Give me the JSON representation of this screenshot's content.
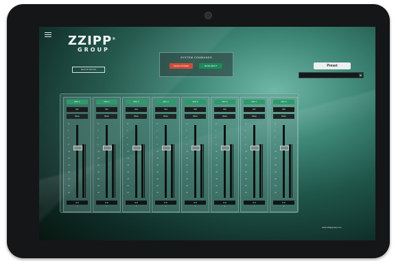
{
  "logo": {
    "line1": "ZZIPP",
    "line2": "GROUP"
  },
  "ip_box": "Neon IP 10.0.0.0",
  "system_commands": {
    "title": "SYSTEM COMMANDS",
    "btn_mute": "MUTE SYSTEM",
    "btn_unmute": "MUTE INPUT"
  },
  "preset": {
    "label": "Preset",
    "selected": ""
  },
  "strips": [
    {
      "name": "MIC 1",
      "label": "IN1",
      "mute": "Mute",
      "value": "0.0",
      "num": "1"
    },
    {
      "name": "MIC 2",
      "label": "IN2",
      "mute": "Mute",
      "value": "0.0",
      "num": "2"
    },
    {
      "name": "MIC 3",
      "label": "IN3",
      "mute": "Mute",
      "value": "0.0",
      "num": "3"
    },
    {
      "name": "MIC 4",
      "label": "IN4",
      "mute": "Mute",
      "value": "0.0",
      "num": "4"
    },
    {
      "name": "MIC 5",
      "label": "IN5",
      "mute": "Mute",
      "value": "0.0",
      "num": "5"
    },
    {
      "name": "MIC 6",
      "label": "IN6",
      "mute": "Mute",
      "value": "0.0",
      "num": "6"
    },
    {
      "name": "MIC 7",
      "label": "IN7",
      "mute": "Mute",
      "value": "0.0",
      "num": "7"
    },
    {
      "name": "MIC 8",
      "label": "IN8",
      "mute": "Mute",
      "value": "0.0",
      "num": "8"
    }
  ],
  "scale_marks": [
    "10",
    "5",
    "0",
    "-5",
    "-10",
    "-15",
    "-20",
    "-30",
    "-40",
    "-50",
    "-60"
  ],
  "website": "www.zzippgroup.com"
}
